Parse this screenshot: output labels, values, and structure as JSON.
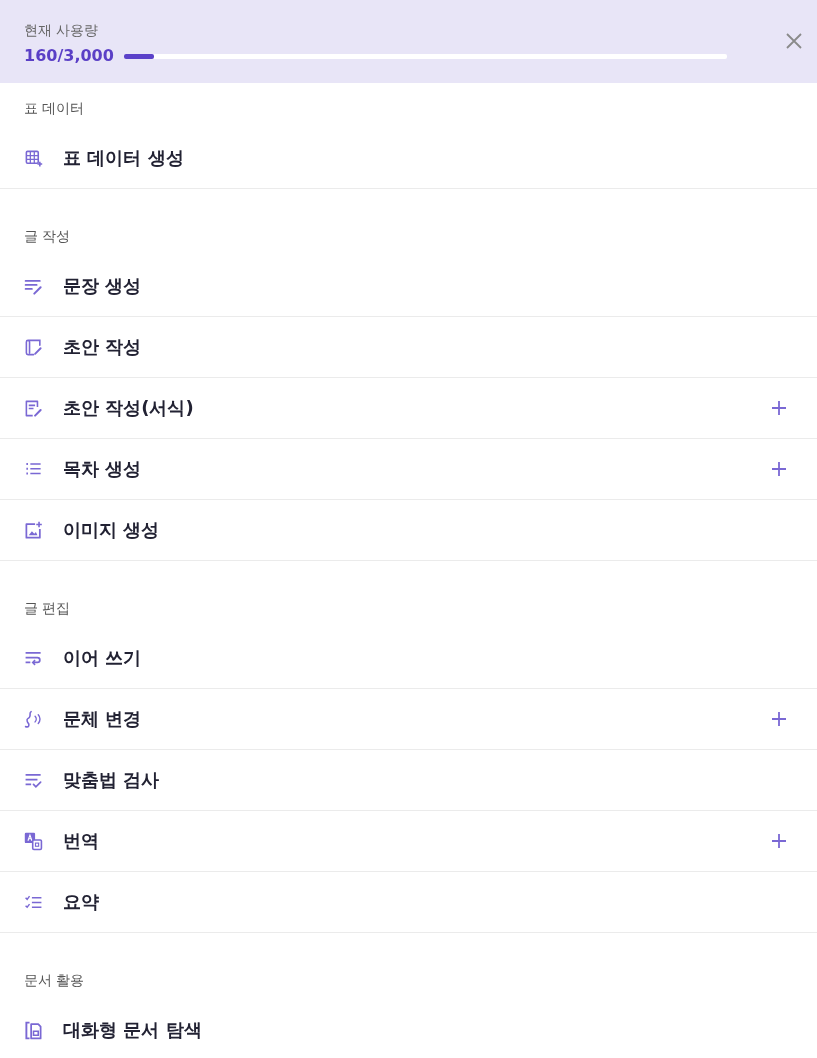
{
  "usage": {
    "label": "현재 사용량",
    "value": "160/3,000",
    "level": 0.05
  },
  "sections": [
    {
      "heading": "표 데이터",
      "items": [
        {
          "label": "표 데이터 생성",
          "expandable": false
        }
      ]
    },
    {
      "heading": "글 작성",
      "items": [
        {
          "label": "문장 생성",
          "expandable": false
        },
        {
          "label": "초안 작성",
          "expandable": false
        },
        {
          "label": "초안 작성(서식)",
          "expandable": true
        },
        {
          "label": "목차 생성",
          "expandable": true
        },
        {
          "label": "이미지 생성",
          "expandable": false
        }
      ]
    },
    {
      "heading": "글 편집",
      "items": [
        {
          "label": "이어 쓰기",
          "expandable": false
        },
        {
          "label": "문체 변경",
          "expandable": true
        },
        {
          "label": "맞춤법 검사",
          "expandable": false
        },
        {
          "label": "번역",
          "expandable": true
        },
        {
          "label": "요약",
          "expandable": false
        }
      ]
    },
    {
      "heading": "문서 활용",
      "items": [
        {
          "label": "대화형 문서 탐색",
          "expandable": false
        }
      ]
    }
  ]
}
